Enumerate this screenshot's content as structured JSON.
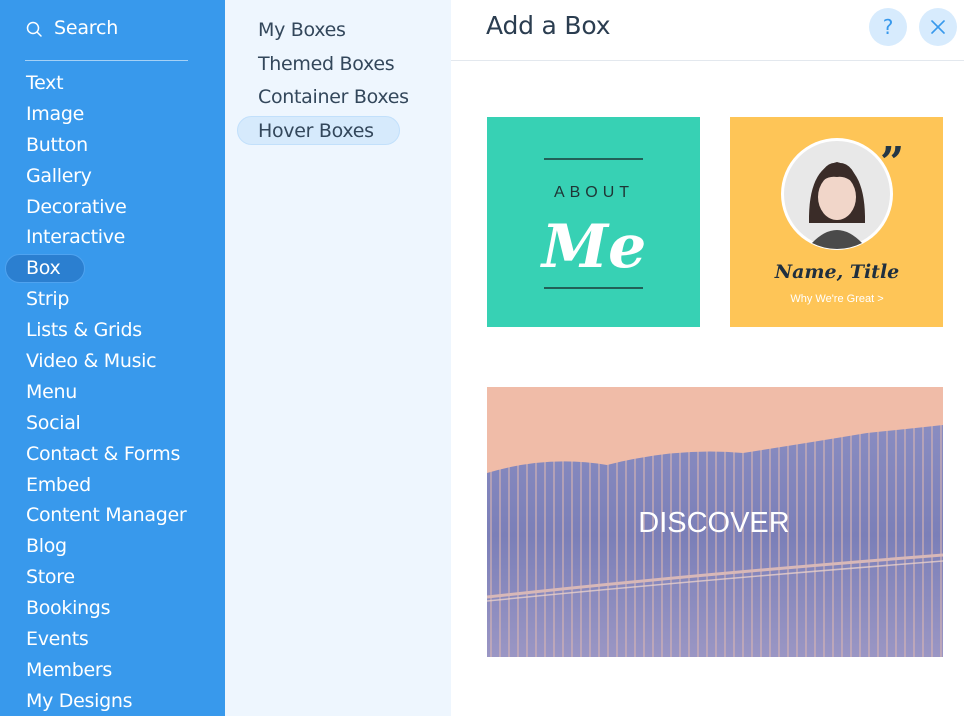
{
  "search": {
    "label": "Search"
  },
  "categories": [
    {
      "label": "Text"
    },
    {
      "label": "Image"
    },
    {
      "label": "Button"
    },
    {
      "label": "Gallery"
    },
    {
      "label": "Decorative"
    },
    {
      "label": "Interactive"
    },
    {
      "label": "Box",
      "selected": true
    },
    {
      "label": "Strip"
    },
    {
      "label": "Lists & Grids"
    },
    {
      "label": "Video & Music"
    },
    {
      "label": "Menu"
    },
    {
      "label": "Social"
    },
    {
      "label": "Contact & Forms"
    },
    {
      "label": "Embed"
    },
    {
      "label": "Content Manager"
    },
    {
      "label": "Blog"
    },
    {
      "label": "Store"
    },
    {
      "label": "Bookings"
    },
    {
      "label": "Events"
    },
    {
      "label": "Members"
    },
    {
      "label": "My Designs"
    }
  ],
  "subcategories": [
    {
      "label": "My Boxes"
    },
    {
      "label": "Themed Boxes"
    },
    {
      "label": "Container Boxes"
    },
    {
      "label": "Hover Boxes",
      "selected": true
    }
  ],
  "panel": {
    "title": "Add a Box",
    "help_icon": "question-icon",
    "close_icon": "close-icon"
  },
  "boxes": {
    "about_me": {
      "line1": "ABOUT",
      "line2": "Me"
    },
    "profile": {
      "name": "Name, Title",
      "link": "Why We're Great >"
    },
    "discover": {
      "label": "DISCOVER"
    }
  },
  "colors": {
    "sidebar": "#3899ec",
    "sidebar_selected": "#2b7fd0",
    "subpanel": "#eef6fe",
    "accent": "#3899ec",
    "teal_box": "#37d1b4",
    "yellow_box": "#fec557",
    "peach_box": "#f0bca8"
  }
}
